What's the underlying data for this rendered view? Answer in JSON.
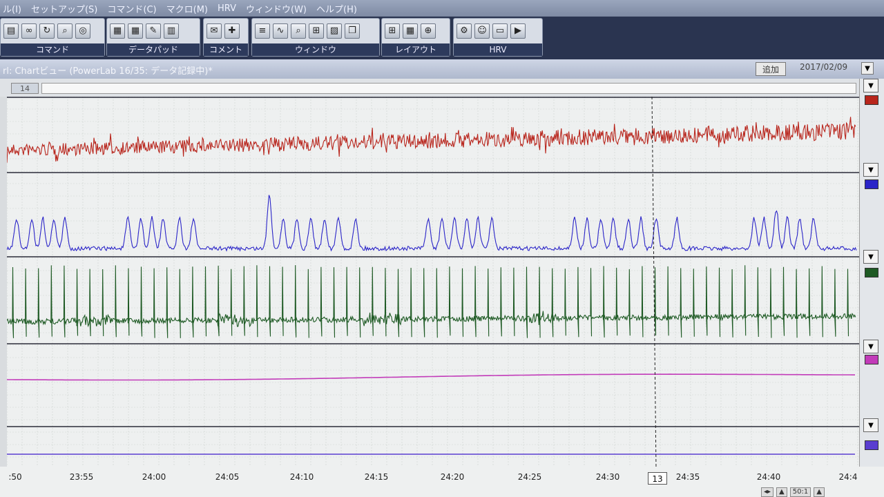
{
  "menu": [
    "ル(I)",
    "セットアップ(S)",
    "コマンド(C)",
    "マクロ(M)",
    "HRV",
    "ウィンドウ(W)",
    "ヘルプ(H)"
  ],
  "toolbar": {
    "groups": [
      {
        "label": "コマンド",
        "icons": [
          "printer-icon",
          "binoculars-icon",
          "refresh-icon",
          "zoom-icon",
          "glasses-icon"
        ]
      },
      {
        "label": "データパッド",
        "icons": [
          "datapad-icon",
          "datapad-add-icon",
          "datapad-edit-icon",
          "datapad-multi-icon"
        ]
      },
      {
        "label": "コメント",
        "icons": [
          "comment-icon",
          "comment-add-icon"
        ]
      },
      {
        "label": "ウィンドウ",
        "icons": [
          "chart-window-icon",
          "scope-icon",
          "zoom-window-icon",
          "xy-window-icon",
          "spectrum-icon",
          "notebook-icon"
        ]
      },
      {
        "label": "レイアウト",
        "icons": [
          "layout-4-icon",
          "layout-grid-icon",
          "layout-add-icon"
        ]
      },
      {
        "label": "HRV",
        "icons": [
          "hrv-settings-icon",
          "subject-icon",
          "report-icon",
          "hrv-start-icon"
        ]
      }
    ]
  },
  "window": {
    "title": "rl: Chartビュー (PowerLab 16/35: データ記録中)*",
    "add_button": "追加",
    "date": "2017/02/09",
    "counter": "14"
  },
  "time_axis": {
    "ticks": [
      ":50",
      "23:55",
      "24:00",
      "24:05",
      "24:10",
      "24:15",
      "24:20",
      "24:25",
      "24:30",
      "24:35",
      "24:40",
      "24:4"
    ],
    "cursor_readout": "13",
    "zoom": "50:1"
  },
  "channels": [
    {
      "color": "#b8251c",
      "kind": "emg"
    },
    {
      "color": "#2a24c8",
      "kind": "respiration"
    },
    {
      "color": "#1e5a24",
      "kind": "ecg"
    },
    {
      "color": "#c23bb9",
      "kind": "flat"
    },
    {
      "color": "#5a3ed0",
      "kind": "flat"
    }
  ],
  "colors": {
    "background": "#eef0f0",
    "grid": "#cdd3cd",
    "divider": "#2a2a38"
  }
}
